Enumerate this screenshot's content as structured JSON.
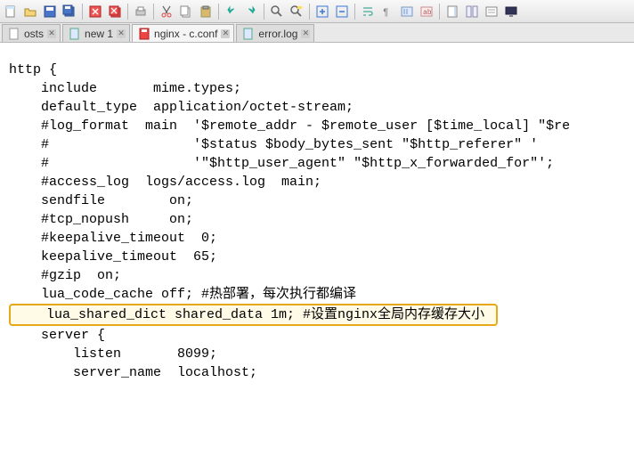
{
  "tabs": [
    {
      "label": "osts",
      "icon": "file-icon"
    },
    {
      "label": "new 1",
      "icon": "file-blue-icon"
    },
    {
      "label": "nginx - c.conf",
      "icon": "disk-red-icon"
    },
    {
      "label": "error.log",
      "icon": "file-blue-icon"
    }
  ],
  "editor": {
    "lines": [
      "",
      "http {",
      "    include       mime.types;",
      "    default_type  application/octet-stream;",
      "",
      "    #log_format  main  '$remote_addr - $remote_user [$time_local] \"$re",
      "    #                  '$status $body_bytes_sent \"$http_referer\" '",
      "    #                  '\"$http_user_agent\" \"$http_x_forwarded_for\"';",
      "",
      "    #access_log  logs/access.log  main;",
      "",
      "    sendfile        on;",
      "    #tcp_nopush     on;",
      "",
      "    #keepalive_timeout  0;",
      "    keepalive_timeout  65;",
      "",
      "    #gzip  on;",
      "    lua_code_cache off; #热部署，每次执行都编译"
    ],
    "highlight": "    lua_shared_dict shared_data 1m; #设置nginx全局内存缓存大小 ",
    "lines_after": [
      "",
      "    server {",
      "        listen       8099;",
      "        server_name  localhost;"
    ]
  }
}
